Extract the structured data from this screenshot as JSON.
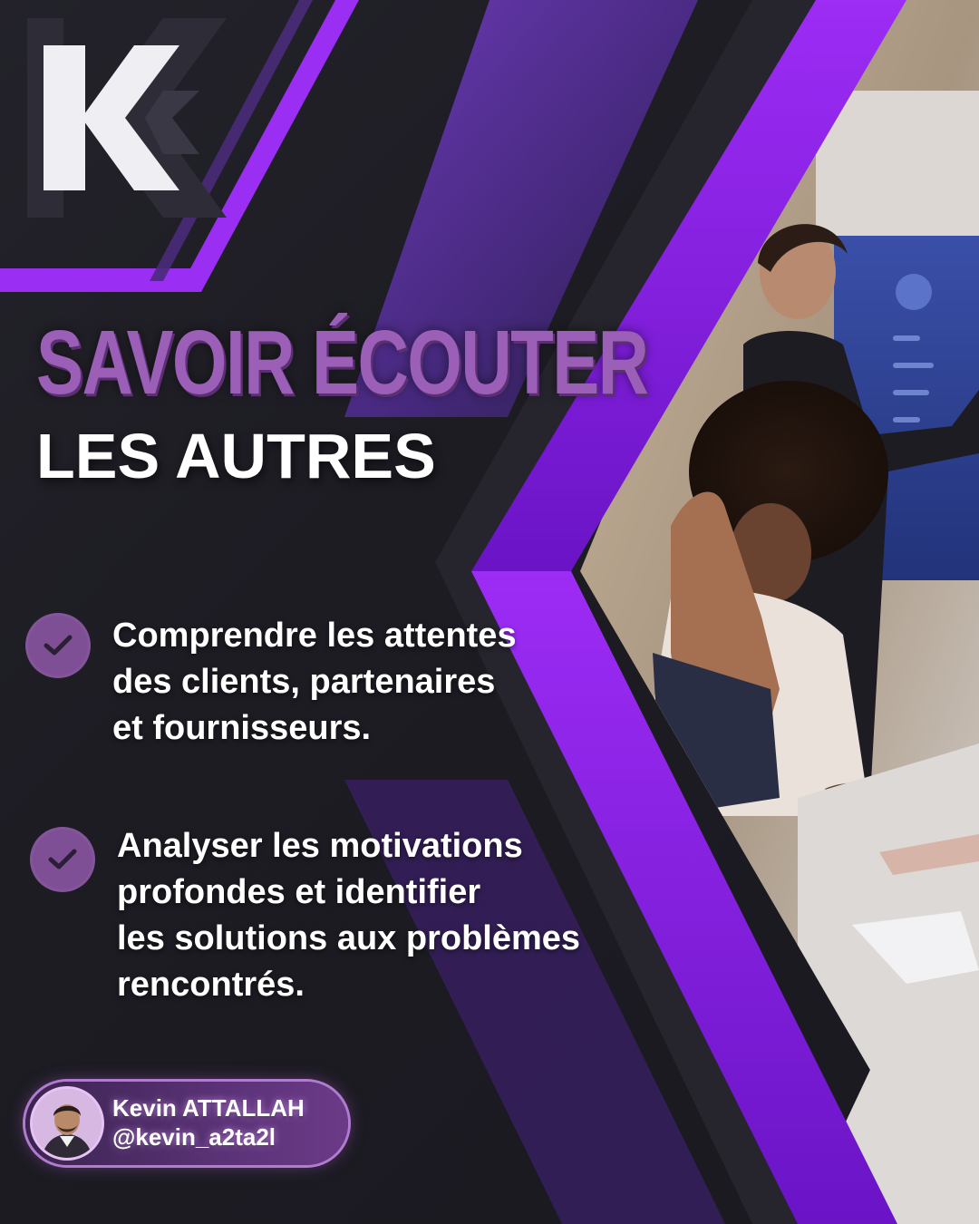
{
  "logo": {
    "letter": "K"
  },
  "headline": {
    "line1": "SAVOIR ÉCOUTER",
    "line2": "LES AUTRES"
  },
  "points": [
    {
      "icon": "check-icon",
      "lines": [
        "Comprendre les attentes",
        "des clients, partenaires",
        "et fournisseurs."
      ]
    },
    {
      "icon": "check-icon",
      "lines": [
        "Analyser les motivations",
        "profondes et identifier",
        "les solutions aux problèmes",
        "rencontrés."
      ]
    }
  ],
  "author": {
    "name": "Kevin ATTALLAH",
    "handle": "@kevin_a2ta2l"
  },
  "colors": {
    "accent": "#8a2be2",
    "headline_purple": "#9b5fb8",
    "badge": "#7f4f96",
    "background": "#1c1b22"
  }
}
